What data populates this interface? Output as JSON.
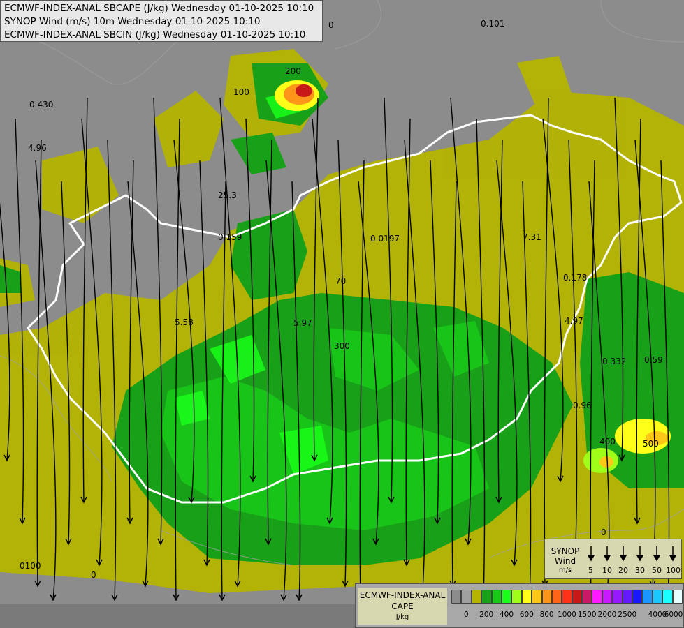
{
  "titles": [
    "ECMWF-INDEX-ANAL SBCAPE (J/kg) Wednesday 01-10-2025 10:10",
    "SYNOP Wind (m/s) 10m Wednesday 01-10-2025 10:10",
    "ECMWF-INDEX-ANAL SBCIN (J/kg) Wednesday 01-10-2025 10:10"
  ],
  "map_labels": [
    {
      "text": "0"
    },
    {
      "text": "0.101"
    },
    {
      "text": "200"
    },
    {
      "text": "100"
    },
    {
      "text": "0.430"
    },
    {
      "text": "4.96"
    },
    {
      "text": "25.3"
    },
    {
      "text": "0.159"
    },
    {
      "text": "0.0197"
    },
    {
      "text": "7.31"
    },
    {
      "text": "70"
    },
    {
      "text": "0.178"
    },
    {
      "text": "5.58"
    },
    {
      "text": "5.97"
    },
    {
      "text": "4.97"
    },
    {
      "text": "300"
    },
    {
      "text": "0.332"
    },
    {
      "text": "0.59"
    },
    {
      "text": "0.96"
    },
    {
      "text": "500"
    },
    {
      "text": "400"
    },
    {
      "text": "0100"
    },
    {
      "text": "0"
    },
    {
      "text": "0"
    }
  ],
  "synop_legend": {
    "title_lines": [
      "SYNOP",
      "Wind",
      "m/s"
    ],
    "speeds": [
      "5",
      "10",
      "20",
      "30",
      "50",
      "100"
    ]
  },
  "cape_legend": {
    "title_lines": [
      "ECMWF-INDEX-ANAL",
      "CAPE",
      "J/kg"
    ],
    "colors": [
      "#8c8c8c",
      "#a0a0a0",
      "#b4b400",
      "#19a019",
      "#19c819",
      "#19ff19",
      "#a0ff19",
      "#ffff19",
      "#ffc819",
      "#ff9619",
      "#ff6419",
      "#ff3219",
      "#c81919",
      "#c81964",
      "#ff19ff",
      "#c819ff",
      "#9619ff",
      "#6419ff",
      "#1919ff",
      "#1996ff",
      "#19c8ff",
      "#19ffff",
      "#e6ffff"
    ],
    "ticks": [
      "0",
      "200",
      "400",
      "600",
      "800",
      "1000",
      "1500",
      "2000",
      "2500",
      "4000",
      "6000"
    ]
  }
}
